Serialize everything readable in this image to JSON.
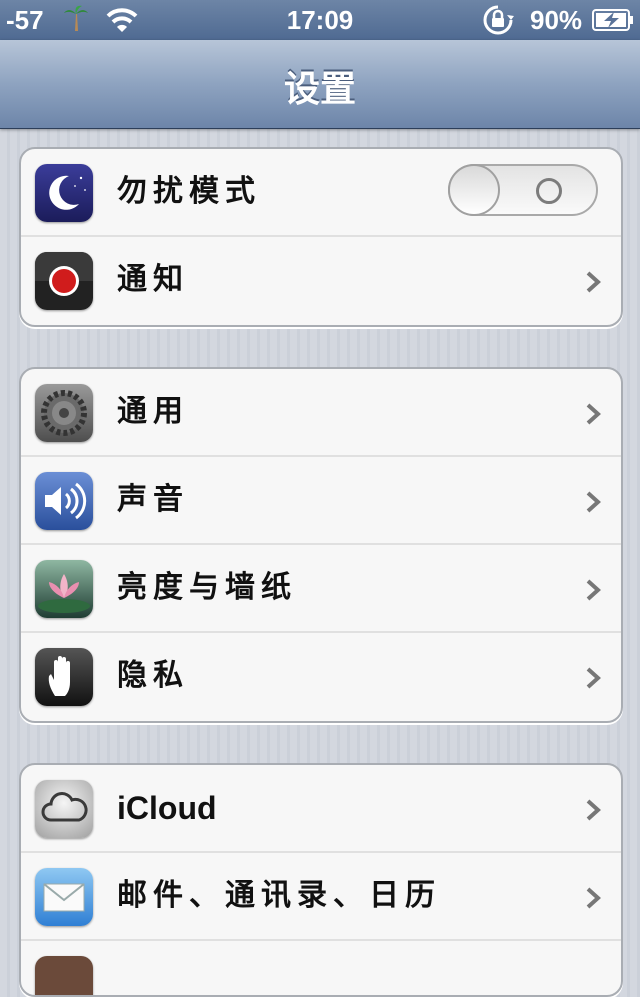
{
  "status_bar": {
    "signal": "-57",
    "time": "17:09",
    "battery_percent": "90%"
  },
  "nav": {
    "title": "设置"
  },
  "groups": [
    {
      "items": [
        {
          "label": "勿扰模式",
          "icon": "moon-icon",
          "control": "toggle",
          "toggle_on": false
        },
        {
          "label": "通知",
          "icon": "notifications-icon",
          "control": "chevron"
        }
      ]
    },
    {
      "items": [
        {
          "label": "通用",
          "icon": "gear-icon",
          "control": "chevron"
        },
        {
          "label": "声音",
          "icon": "speaker-icon",
          "control": "chevron"
        },
        {
          "label": "亮度与墙纸",
          "icon": "lotus-wallpaper-icon",
          "control": "chevron"
        },
        {
          "label": "隐私",
          "icon": "hand-icon",
          "control": "chevron"
        }
      ]
    },
    {
      "items": [
        {
          "label": "iCloud",
          "icon": "cloud-icon",
          "control": "chevron"
        },
        {
          "label": "邮件、通讯录、日历",
          "icon": "mail-icon",
          "control": "chevron"
        }
      ]
    }
  ],
  "colors": {
    "status_bar": "#5a7399",
    "nav_bar": "#8ea3c0",
    "group_bg": "#f7f7f7",
    "page_bg": "#d3d7df"
  }
}
